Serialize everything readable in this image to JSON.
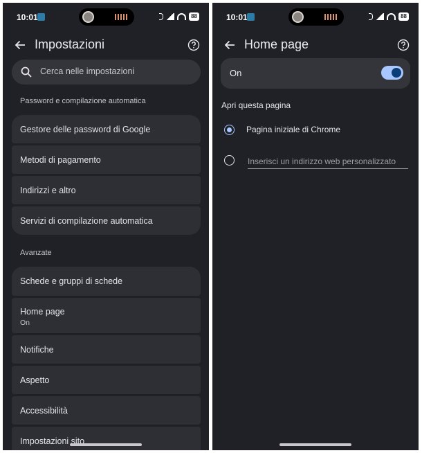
{
  "status_bar": {
    "time": "10:01",
    "battery": "88"
  },
  "settings_screen": {
    "title": "Impostazioni",
    "search_placeholder": "Cerca nelle impostazioni",
    "section_autofill": "Password e compilazione automatica",
    "autofill_items": [
      {
        "label": "Gestore delle password di Google"
      },
      {
        "label": "Metodi di pagamento"
      },
      {
        "label": "Indirizzi e altro"
      },
      {
        "label": "Servizi di compilazione automatica"
      }
    ],
    "section_advanced": "Avanzate",
    "advanced_items": [
      {
        "label": "Schede e gruppi di schede"
      },
      {
        "label": "Home page",
        "sublabel": "On"
      },
      {
        "label": "Notifiche"
      },
      {
        "label": "Aspetto"
      },
      {
        "label": "Accessibilità"
      },
      {
        "label": "Impostazioni sito"
      }
    ]
  },
  "homepage_screen": {
    "title": "Home page",
    "toggle_label": "On",
    "toggle_on": true,
    "open_heading": "Apri questa pagina",
    "option_chrome": "Pagina iniziale di Chrome",
    "option_custom_placeholder": "Inserisci un indirizzo web personalizzato",
    "selected_option": "chrome"
  },
  "icons": [
    "back-arrow-icon",
    "help-icon",
    "search-icon",
    "bluetooth-icon",
    "signal-icon",
    "wifi-icon",
    "battery-icon"
  ]
}
